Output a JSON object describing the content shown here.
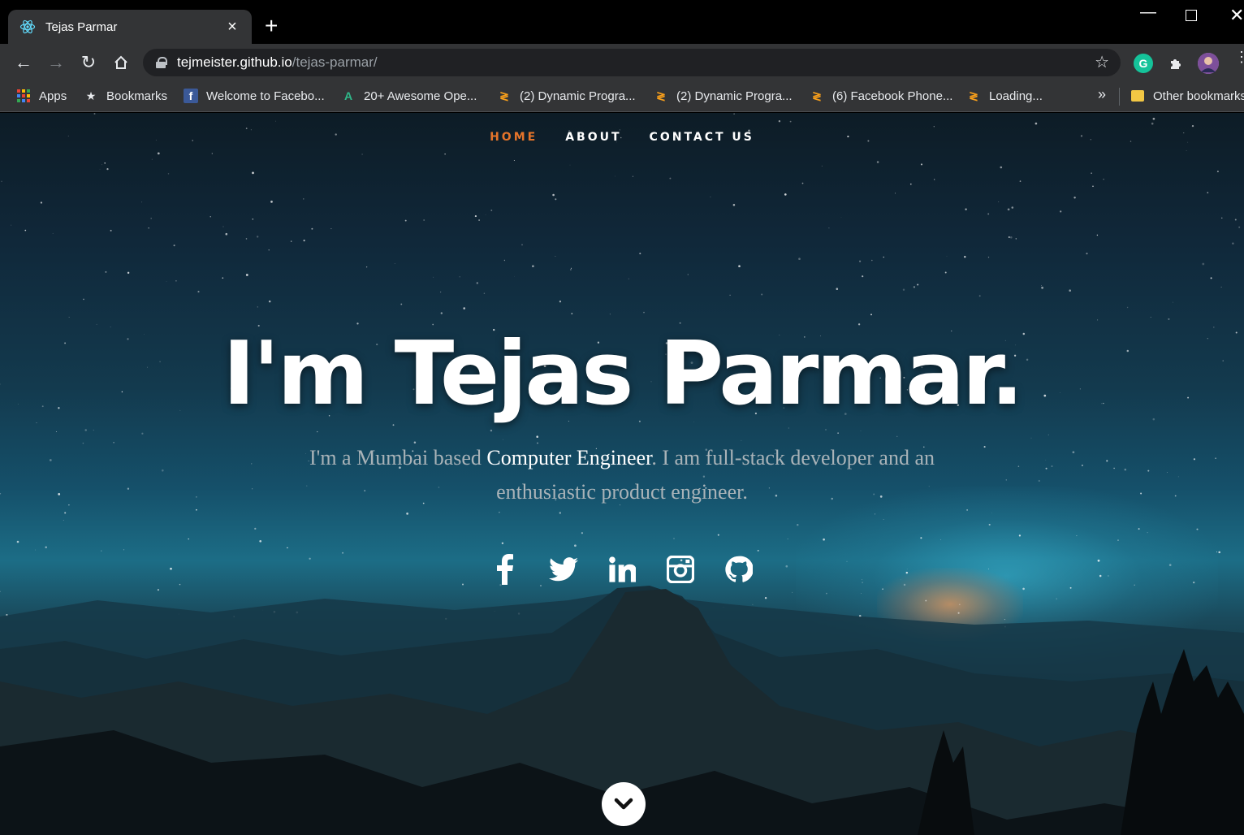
{
  "browser": {
    "tab": {
      "title": "Tejas Parmar",
      "favicon": "react-atom-icon"
    },
    "new_tab_label": "+",
    "address": {
      "host": "tejmeister.github.io",
      "path": "/tejas-parmar/"
    },
    "extensions": {
      "grammarly_label": "G"
    },
    "bookmarks": [
      {
        "label": "Apps",
        "icon": "apps-grid-icon"
      },
      {
        "label": "Bookmarks",
        "icon": "star-icon"
      },
      {
        "label": "Welcome to Facebo...",
        "icon": "facebook-icon"
      },
      {
        "label": "20+ Awesome Ope...",
        "icon": "green-a-icon"
      },
      {
        "label": "(2) Dynamic Progra...",
        "icon": "hackerrank-icon"
      },
      {
        "label": "(2) Dynamic Progra...",
        "icon": "hackerrank-icon"
      },
      {
        "label": "(6) Facebook Phone...",
        "icon": "hackerrank-icon"
      },
      {
        "label": "Loading...",
        "icon": "hackerrank-icon"
      },
      {
        "label": "Other bookmarks",
        "icon": "folder-icon"
      }
    ],
    "bookmarks_overflow": "»"
  },
  "site": {
    "nav": [
      {
        "label": "HOME",
        "active": true
      },
      {
        "label": "ABOUT",
        "active": false
      },
      {
        "label": "CONTACT US",
        "active": false
      }
    ],
    "hero": {
      "title": "I'm Tejas Parmar.",
      "subtitle_pre": "I'm a Mumbai based ",
      "subtitle_highlight": "Computer Engineer",
      "subtitle_post": ". I am full-stack developer and an enthusiastic product engineer."
    },
    "social": [
      "facebook-icon",
      "twitter-icon",
      "linkedin-icon",
      "instagram-icon",
      "github-icon"
    ],
    "colors": {
      "accent": "#e5742a",
      "text": "#ffffff",
      "muted": "#a9b3b8"
    }
  }
}
